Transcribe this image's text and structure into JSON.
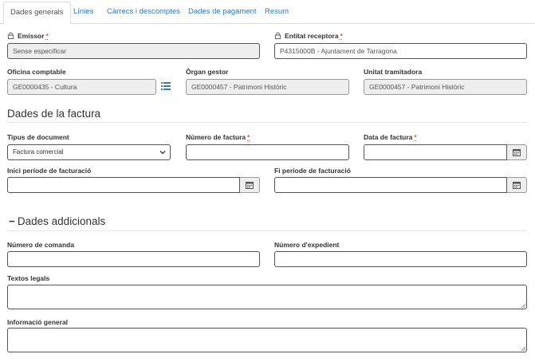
{
  "tabs": [
    {
      "label": "Dades generals",
      "active": true
    },
    {
      "label": "Línies",
      "active": false
    },
    {
      "label": "Càrrecs i descomptes",
      "active": false
    },
    {
      "label": "Dades de pagament",
      "active": false
    },
    {
      "label": "Resum",
      "active": false
    }
  ],
  "general": {
    "emissor_label": "Emissor",
    "emissor_value": "Sense especificar",
    "entitat_label": "Entitat receptora",
    "entitat_value": "P4315000B - Ajuntament de Tarragona",
    "oficina_label": "Oficina comptable",
    "oficina_value": "GE0000435 - Cultura",
    "organ_label": "Òrgan gestor",
    "organ_value": "GE0000457 - Patrimoni Històric",
    "unitat_label": "Unitat tramitadora",
    "unitat_value": "GE0000457 - Patrimoni Històric",
    "required_mark": "*"
  },
  "factura": {
    "section_title": "Dades de la factura",
    "tipus_label": "Tipus de document",
    "tipus_value": "Factura comercial",
    "numero_label": "Número de factura",
    "numero_value": "",
    "data_label": "Data de factura",
    "data_value": "",
    "inici_label": "Inici període de facturació",
    "inici_value": "",
    "fi_label": "Fi període de facturació",
    "fi_value": ""
  },
  "addicionals": {
    "toggle_symbol": "−",
    "section_title": "Dades addicionals",
    "comanda_label": "Número de comanda",
    "comanda_value": "",
    "expedient_label": "Número d'expedient",
    "expedient_value": "",
    "textos_label": "Textos legals",
    "textos_value": "",
    "info_label": "Informació general",
    "info_value": ""
  },
  "icons": {
    "lock": "lock-icon",
    "list": "list-icon",
    "calendar": "calendar-icon",
    "chevron": "chevron-down-icon"
  },
  "colors": {
    "link": "#337ab7",
    "required": "#d9534f",
    "readonly_bg": "#eeeeee"
  }
}
